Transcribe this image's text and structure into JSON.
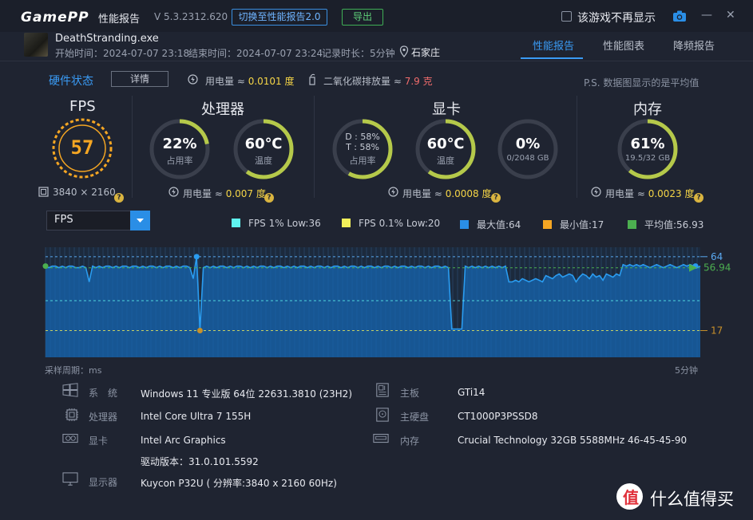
{
  "titlebar": {
    "logo": "GamePP",
    "title": "性能报告",
    "version": "V 5.3.2312.620",
    "switch_button": "切换至性能报告2.0",
    "export_button": "导出",
    "checkbox_label": "该游戏不再显示",
    "minimize": "—",
    "close": "✕"
  },
  "session": {
    "exe": "DeathStranding.exe",
    "start": "开始时间：2024-07-07 23:18",
    "end": "结束时间：2024-07-07 23:24",
    "duration": "记录时长：5分钟",
    "city": "石家庄"
  },
  "tabs": [
    "性能报告",
    "性能图表",
    "降频报告"
  ],
  "status": {
    "title": "硬件状态",
    "detail_button": "详情",
    "power_label": "用电量 ≈ ",
    "power_value": "0.0101 度",
    "co2_label": "二氧化碳排放量 ≈ ",
    "co2_value": "7.9 克",
    "note": "P.S. 数据图显示的是平均值"
  },
  "panels": {
    "fps": {
      "title": "FPS",
      "value": "57",
      "resolution": "3840 × 2160"
    },
    "cpu": {
      "title": "处理器",
      "usage_value": "22%",
      "usage_label": "占用率",
      "usage_fraction": 0.22,
      "temp_value": "60℃",
      "temp_label": "温度",
      "temp_fraction": 0.6,
      "power_label": "用电量 ≈ ",
      "power_value": "0.007 度"
    },
    "gpu": {
      "title": "显卡",
      "usage_line1": "D : 58%",
      "usage_line2": "T : 58%",
      "usage_label": "占用率",
      "usage_fraction": 0.58,
      "temp_value": "60℃",
      "temp_label": "温度",
      "temp_fraction": 0.6,
      "vram_value": "0%",
      "vram_label": "0/2048 GB",
      "vram_fraction": 0.0,
      "power_label": "用电量 ≈ ",
      "power_value": "0.0008 度"
    },
    "mem": {
      "title": "内存",
      "value": "61%",
      "label": "19.5/32 GB",
      "fraction": 0.61,
      "power_label": "用电量 ≈ ",
      "power_value": "0.0023 度"
    }
  },
  "chart_controls": {
    "selected": "FPS",
    "legend": [
      {
        "label": "FPS 1% Low:36",
        "color": "#5ff5f0"
      },
      {
        "label": "FPS 0.1% Low:20",
        "color": "#f2f05a"
      },
      {
        "label": "最大值:64",
        "color": "#2a8ee6"
      },
      {
        "label": "最小值:17",
        "color": "#f5a623"
      },
      {
        "label": "平均值:56.93",
        "color": "#4caf50"
      }
    ]
  },
  "chart_data": {
    "type": "area",
    "series": [
      {
        "name": "FPS",
        "values": [
          58,
          57,
          58,
          58,
          57,
          58,
          57,
          58,
          58,
          57,
          57,
          58,
          57,
          48,
          58,
          57,
          58,
          57,
          58,
          58,
          57,
          58,
          57,
          58,
          58,
          57,
          58,
          58,
          57,
          58,
          57,
          58,
          58,
          57,
          58,
          57,
          58,
          58,
          57,
          58,
          57,
          58,
          58,
          57,
          50,
          64,
          17,
          57,
          58,
          57,
          58,
          57,
          58,
          58,
          57,
          58,
          57,
          58,
          58,
          57,
          58,
          57,
          58,
          57,
          58,
          58,
          57,
          58,
          57,
          58,
          58,
          57,
          58,
          57,
          58,
          57,
          58,
          58,
          57,
          58,
          57,
          58,
          58,
          57,
          58,
          57,
          58,
          58,
          57,
          58,
          57,
          58,
          58,
          57,
          58,
          57,
          58,
          58,
          57,
          58,
          57,
          58,
          58,
          57,
          58,
          57,
          58,
          58,
          57,
          58,
          57,
          58,
          58,
          57,
          58,
          57,
          58,
          58,
          57,
          58,
          57,
          18,
          18,
          18,
          18,
          58,
          57,
          58,
          57,
          58,
          57,
          58,
          57,
          58,
          57,
          58,
          57,
          58,
          48,
          48,
          49,
          48,
          50,
          49,
          48,
          49,
          50,
          49,
          48,
          52,
          51,
          50,
          52,
          53,
          51,
          52,
          53,
          52,
          48,
          51,
          53,
          52,
          50,
          53,
          51,
          52,
          49,
          53,
          52,
          51,
          53,
          52,
          59,
          58,
          59,
          58,
          59,
          58,
          59,
          58,
          57,
          58,
          59,
          58,
          57,
          58,
          59,
          58,
          57,
          58,
          59,
          58,
          59,
          58,
          57,
          58
        ]
      }
    ],
    "markers": {
      "max": 64,
      "min": 17,
      "avg": 56.94
    },
    "ylim": [
      0,
      70
    ],
    "x_start_label": "采样周期：ms",
    "x_end_label": "5分钟",
    "grid": true
  },
  "sysinfo": {
    "left": [
      {
        "label": "系　统",
        "value": "Windows 11 专业版 64位 22631.3810 (23H2)",
        "icon": "windows-icon"
      },
      {
        "label": "处理器",
        "value": "Intel Core Ultra 7 155H",
        "icon": "cpu-icon"
      },
      {
        "label": "显卡",
        "value": "Intel Arc Graphics",
        "icon": "gpu-icon"
      },
      {
        "label": "",
        "value": "驱动版本：31.0.101.5592",
        "icon": ""
      },
      {
        "label": "显示器",
        "value": "Kuycon P32U ( 分辨率:3840 x 2160 60Hz)",
        "icon": "monitor-icon"
      }
    ],
    "right": [
      {
        "label": "主板",
        "value": "GTi14",
        "icon": "motherboard-icon"
      },
      {
        "label": "主硬盘",
        "value": "CT1000P3PSSD8",
        "icon": "disk-icon"
      },
      {
        "label": "内存",
        "value": "Crucial Technology 32GB 5588MHz 46-45-45-90",
        "icon": "ram-icon"
      }
    ]
  },
  "watermark": "什么值得买",
  "colors": {
    "accent": "#3a9bf5",
    "ring_track": "#3a3f4c",
    "ring_fill": "#b5c94a",
    "fps_ring": "#f5a623"
  }
}
